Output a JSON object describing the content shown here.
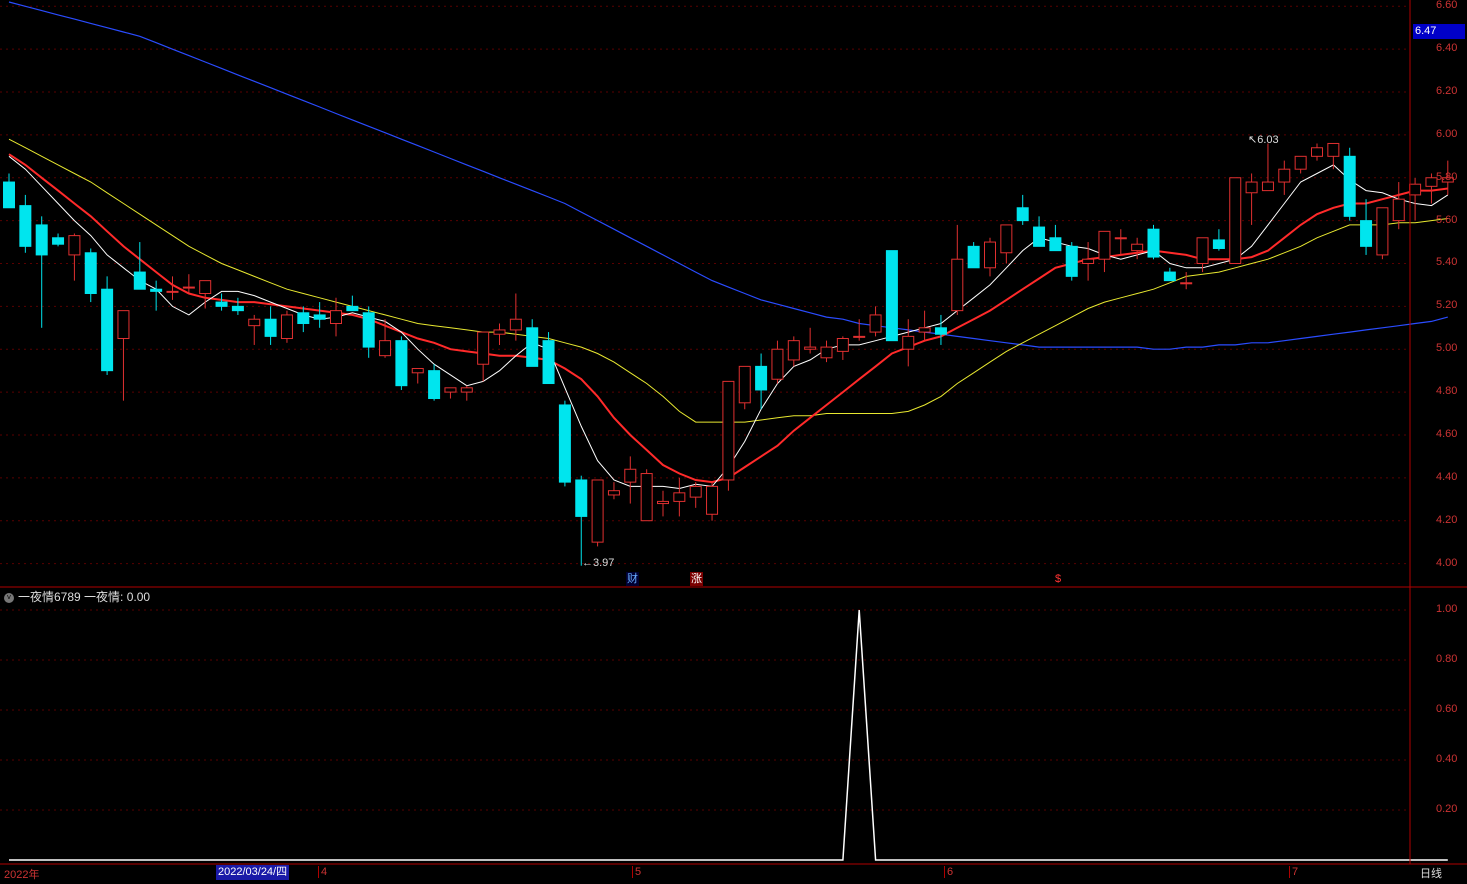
{
  "colors": {
    "up": "#e03030",
    "down": "#00e5ee",
    "grid": "#5a0000",
    "axis": "#b00000",
    "ma5": "#ffffff",
    "ma10": "#ff2a2a",
    "ma20": "#e8e830",
    "ma60": "#2a4cff",
    "indicator_line": "#ffffff",
    "cursor_label_bg": "#1a1aa8",
    "current_price_bg": "#0000c8"
  },
  "price_axis": {
    "min": 3.9,
    "max": 6.62,
    "ticks": [
      "6.60",
      "6.40",
      "6.20",
      "6.00",
      "5.80",
      "5.60",
      "5.40",
      "5.20",
      "5.00",
      "4.80",
      "4.60",
      "4.40",
      "4.20",
      "4.00"
    ],
    "current_price": "6.47"
  },
  "indicator": {
    "collapse_icon": "circle-chevron-icon",
    "name": "一夜情6789",
    "value_label": "一夜情: 0.00",
    "ticks": [
      "1.00",
      "0.80",
      "0.60",
      "0.40",
      "0.20"
    ]
  },
  "annotations": {
    "high": "6.03",
    "low": "3.97"
  },
  "event_marks": [
    {
      "text": "财",
      "color": "#66aaff",
      "bg": "#000033"
    },
    {
      "text": "涨",
      "color": "#ffffff",
      "bg": "#7a0000"
    },
    {
      "text": "$",
      "color": "#ff3333",
      "bg": "#000000"
    }
  ],
  "date_axis": {
    "year_label": "2022年",
    "cursor_date": "2022/03/24/四",
    "month_labels": [
      "4",
      "5",
      "6",
      "7"
    ]
  },
  "period_button": "日线",
  "chart_data": {
    "type": "candlestick",
    "ohlc": [
      [
        5.78,
        5.82,
        5.7,
        5.66
      ],
      [
        5.67,
        5.72,
        5.45,
        5.48
      ],
      [
        5.58,
        5.62,
        5.1,
        5.44
      ],
      [
        5.52,
        5.54,
        5.48,
        5.49
      ],
      [
        5.44,
        5.54,
        5.32,
        5.53
      ],
      [
        5.45,
        5.47,
        5.22,
        5.26
      ],
      [
        5.28,
        5.34,
        4.88,
        4.9
      ],
      [
        5.05,
        5.18,
        4.76,
        5.18
      ],
      [
        5.36,
        5.5,
        5.28,
        5.28
      ],
      [
        5.28,
        5.32,
        5.18,
        5.27
      ],
      [
        5.27,
        5.34,
        5.23,
        5.27
      ],
      [
        5.29,
        5.35,
        5.26,
        5.29
      ],
      [
        5.26,
        5.32,
        5.19,
        5.32
      ],
      [
        5.22,
        5.26,
        5.18,
        5.2
      ],
      [
        5.2,
        5.24,
        5.16,
        5.18
      ],
      [
        5.11,
        5.16,
        5.02,
        5.14
      ],
      [
        5.14,
        5.2,
        5.02,
        5.06
      ],
      [
        5.05,
        5.18,
        5.03,
        5.16
      ],
      [
        5.17,
        5.2,
        5.08,
        5.12
      ],
      [
        5.16,
        5.22,
        5.1,
        5.14
      ],
      [
        5.12,
        5.24,
        5.06,
        5.18
      ],
      [
        5.2,
        5.25,
        5.18,
        5.18
      ],
      [
        5.17,
        5.2,
        4.96,
        5.01
      ],
      [
        4.97,
        5.14,
        4.96,
        5.04
      ],
      [
        5.04,
        5.06,
        4.81,
        4.83
      ],
      [
        4.89,
        4.91,
        4.84,
        4.91
      ],
      [
        4.9,
        4.93,
        4.76,
        4.77
      ],
      [
        4.8,
        4.82,
        4.77,
        4.82
      ],
      [
        4.8,
        4.83,
        4.76,
        4.82
      ],
      [
        4.93,
        5.08,
        4.85,
        5.08
      ],
      [
        5.07,
        5.12,
        5.02,
        5.09
      ],
      [
        5.09,
        5.26,
        5.04,
        5.14
      ],
      [
        5.1,
        5.14,
        4.92,
        4.92
      ],
      [
        5.04,
        5.08,
        4.84,
        4.84
      ],
      [
        4.74,
        4.76,
        4.36,
        4.38
      ],
      [
        4.39,
        4.41,
        3.99,
        4.22
      ],
      [
        4.1,
        4.18,
        4.08,
        4.39
      ],
      [
        4.32,
        4.38,
        4.3,
        4.34
      ],
      [
        4.38,
        4.5,
        4.28,
        4.44
      ],
      [
        4.2,
        4.44,
        4.2,
        4.42
      ],
      [
        4.28,
        4.34,
        4.22,
        4.29
      ],
      [
        4.29,
        4.4,
        4.22,
        4.33
      ],
      [
        4.31,
        4.38,
        4.26,
        4.36
      ],
      [
        4.23,
        4.38,
        4.2,
        4.36
      ],
      [
        4.39,
        4.56,
        4.34,
        4.85
      ],
      [
        4.75,
        4.92,
        4.72,
        4.92
      ],
      [
        4.92,
        4.98,
        4.72,
        4.81
      ],
      [
        4.86,
        5.04,
        4.84,
        5.0
      ],
      [
        4.95,
        5.06,
        4.92,
        5.04
      ],
      [
        5.0,
        5.1,
        4.98,
        5.01
      ],
      [
        4.96,
        5.04,
        4.94,
        5.01
      ],
      [
        4.99,
        5.06,
        4.95,
        5.05
      ],
      [
        5.06,
        5.14,
        5.04,
        5.06
      ],
      [
        5.08,
        5.2,
        5.06,
        5.16
      ],
      [
        5.46,
        5.46,
        5.04,
        5.04
      ],
      [
        5.0,
        5.14,
        4.92,
        5.06
      ],
      [
        5.08,
        5.18,
        5.04,
        5.1
      ],
      [
        5.1,
        5.16,
        5.02,
        5.07
      ],
      [
        5.18,
        5.58,
        5.16,
        5.42
      ],
      [
        5.48,
        5.5,
        5.4,
        5.38
      ],
      [
        5.38,
        5.52,
        5.34,
        5.5
      ],
      [
        5.45,
        5.56,
        5.4,
        5.58
      ],
      [
        5.66,
        5.72,
        5.58,
        5.6
      ],
      [
        5.57,
        5.62,
        5.48,
        5.48
      ],
      [
        5.52,
        5.58,
        5.46,
        5.46
      ],
      [
        5.48,
        5.5,
        5.32,
        5.34
      ],
      [
        5.4,
        5.5,
        5.32,
        5.42
      ],
      [
        5.42,
        5.55,
        5.36,
        5.55
      ],
      [
        5.52,
        5.56,
        5.44,
        5.52
      ],
      [
        5.46,
        5.52,
        5.42,
        5.49
      ],
      [
        5.56,
        5.58,
        5.42,
        5.43
      ],
      [
        5.36,
        5.38,
        5.32,
        5.32
      ],
      [
        5.31,
        5.36,
        5.28,
        5.31
      ],
      [
        5.4,
        5.5,
        5.36,
        5.52
      ],
      [
        5.51,
        5.56,
        5.46,
        5.47
      ],
      [
        5.4,
        5.66,
        5.4,
        5.8
      ],
      [
        5.73,
        5.82,
        5.58,
        5.78
      ],
      [
        5.74,
        5.96,
        5.74,
        5.78
      ],
      [
        5.78,
        5.88,
        5.72,
        5.84
      ],
      [
        5.84,
        5.9,
        5.82,
        5.9
      ],
      [
        5.9,
        5.96,
        5.88,
        5.94
      ],
      [
        5.9,
        5.96,
        5.84,
        5.96
      ],
      [
        5.9,
        5.94,
        5.6,
        5.62
      ],
      [
        5.6,
        5.7,
        5.44,
        5.48
      ],
      [
        5.44,
        5.66,
        5.42,
        5.66
      ],
      [
        5.6,
        5.78,
        5.56,
        5.7
      ],
      [
        5.72,
        5.8,
        5.6,
        5.77
      ],
      [
        5.76,
        5.82,
        5.68,
        5.8
      ],
      [
        5.78,
        5.88,
        5.72,
        5.8
      ]
    ],
    "ma5": [
      5.9,
      5.84,
      5.76,
      5.68,
      5.6,
      5.53,
      5.44,
      5.38,
      5.32,
      5.28,
      5.2,
      5.16,
      5.22,
      5.27,
      5.27,
      5.25,
      5.22,
      5.19,
      5.16,
      5.14,
      5.15,
      5.17,
      5.15,
      5.13,
      5.08,
      5.0,
      4.93,
      4.88,
      4.83,
      4.85,
      4.9,
      4.97,
      5.03,
      5.0,
      4.82,
      4.64,
      4.48,
      4.39,
      4.36,
      4.36,
      4.36,
      4.35,
      4.37,
      4.36,
      4.45,
      4.57,
      4.72,
      4.84,
      4.92,
      4.95,
      5.0,
      5.02,
      5.02,
      5.04,
      5.06,
      5.08,
      5.1,
      5.12,
      5.18,
      5.24,
      5.3,
      5.38,
      5.46,
      5.52,
      5.5,
      5.48,
      5.47,
      5.44,
      5.42,
      5.44,
      5.46,
      5.4,
      5.38,
      5.38,
      5.4,
      5.42,
      5.48,
      5.58,
      5.68,
      5.78,
      5.82,
      5.86,
      5.79,
      5.74,
      5.73,
      5.7,
      5.68,
      5.67,
      5.72
    ],
    "ma10": [
      5.91,
      5.86,
      5.8,
      5.74,
      5.68,
      5.62,
      5.55,
      5.48,
      5.42,
      5.36,
      5.3,
      5.26,
      5.24,
      5.23,
      5.22,
      5.22,
      5.21,
      5.2,
      5.19,
      5.18,
      5.17,
      5.16,
      5.14,
      5.11,
      5.08,
      5.05,
      5.03,
      5.0,
      4.99,
      4.98,
      4.97,
      4.97,
      4.96,
      4.95,
      4.91,
      4.86,
      4.78,
      4.68,
      4.6,
      4.53,
      4.46,
      4.42,
      4.39,
      4.38,
      4.4,
      4.45,
      4.5,
      4.55,
      4.62,
      4.68,
      4.74,
      4.8,
      4.86,
      4.92,
      4.98,
      5.01,
      5.04,
      5.06,
      5.1,
      5.14,
      5.18,
      5.23,
      5.28,
      5.33,
      5.38,
      5.4,
      5.42,
      5.43,
      5.44,
      5.45,
      5.46,
      5.45,
      5.44,
      5.42,
      5.42,
      5.42,
      5.43,
      5.46,
      5.52,
      5.58,
      5.63,
      5.66,
      5.68,
      5.68,
      5.7,
      5.72,
      5.74,
      5.74,
      5.75
    ],
    "ma20": [
      5.98,
      5.94,
      5.9,
      5.86,
      5.82,
      5.78,
      5.73,
      5.68,
      5.63,
      5.58,
      5.53,
      5.48,
      5.44,
      5.4,
      5.37,
      5.34,
      5.31,
      5.28,
      5.26,
      5.24,
      5.22,
      5.2,
      5.18,
      5.16,
      5.14,
      5.12,
      5.11,
      5.1,
      5.09,
      5.08,
      5.08,
      5.07,
      5.06,
      5.05,
      5.03,
      5.01,
      4.98,
      4.94,
      4.89,
      4.84,
      4.78,
      4.71,
      4.66,
      4.66,
      4.66,
      4.66,
      4.67,
      4.68,
      4.69,
      4.69,
      4.7,
      4.7,
      4.7,
      4.7,
      4.7,
      4.71,
      4.74,
      4.78,
      4.84,
      4.89,
      4.94,
      4.99,
      5.03,
      5.07,
      5.11,
      5.15,
      5.19,
      5.22,
      5.24,
      5.26,
      5.28,
      5.31,
      5.34,
      5.35,
      5.36,
      5.38,
      5.4,
      5.42,
      5.45,
      5.48,
      5.52,
      5.55,
      5.58,
      5.58,
      5.58,
      5.59,
      5.59,
      5.6,
      5.61
    ],
    "ma60": [
      6.62,
      6.6,
      6.58,
      6.56,
      6.54,
      6.52,
      6.5,
      6.48,
      6.46,
      6.43,
      6.4,
      6.37,
      6.34,
      6.31,
      6.28,
      6.25,
      6.22,
      6.19,
      6.16,
      6.13,
      6.1,
      6.07,
      6.04,
      6.01,
      5.98,
      5.95,
      5.92,
      5.89,
      5.86,
      5.83,
      5.8,
      5.77,
      5.74,
      5.71,
      5.68,
      5.64,
      5.6,
      5.56,
      5.52,
      5.48,
      5.44,
      5.4,
      5.36,
      5.32,
      5.29,
      5.26,
      5.23,
      5.21,
      5.19,
      5.17,
      5.15,
      5.14,
      5.12,
      5.11,
      5.1,
      5.09,
      5.08,
      5.07,
      5.06,
      5.05,
      5.04,
      5.03,
      5.02,
      5.01,
      5.01,
      5.01,
      5.01,
      5.01,
      5.01,
      5.01,
      5.0,
      5.0,
      5.01,
      5.01,
      5.02,
      5.02,
      5.03,
      5.03,
      5.04,
      5.05,
      5.06,
      5.07,
      5.08,
      5.09,
      5.1,
      5.11,
      5.12,
      5.13,
      5.15
    ],
    "indicator_values": [
      0,
      0,
      0,
      0,
      0,
      0,
      0,
      0,
      0,
      0,
      0,
      0,
      0,
      0,
      0,
      0,
      0,
      0,
      0,
      0,
      0,
      0,
      0,
      0,
      0,
      0,
      0,
      0,
      0,
      0,
      0,
      0,
      0,
      0,
      0,
      0,
      0,
      0,
      0,
      0,
      0,
      0,
      0,
      0,
      0,
      0,
      0,
      0,
      0,
      0,
      0,
      0,
      1,
      0,
      0,
      0,
      0,
      0,
      0,
      0,
      0,
      0,
      0,
      0,
      0,
      0,
      0,
      0,
      0,
      0,
      0,
      0,
      0,
      0,
      0,
      0,
      0,
      0,
      0,
      0,
      0,
      0,
      0,
      0,
      0,
      0,
      0,
      0,
      0
    ],
    "indicator_ylim": [
      0,
      1
    ]
  }
}
